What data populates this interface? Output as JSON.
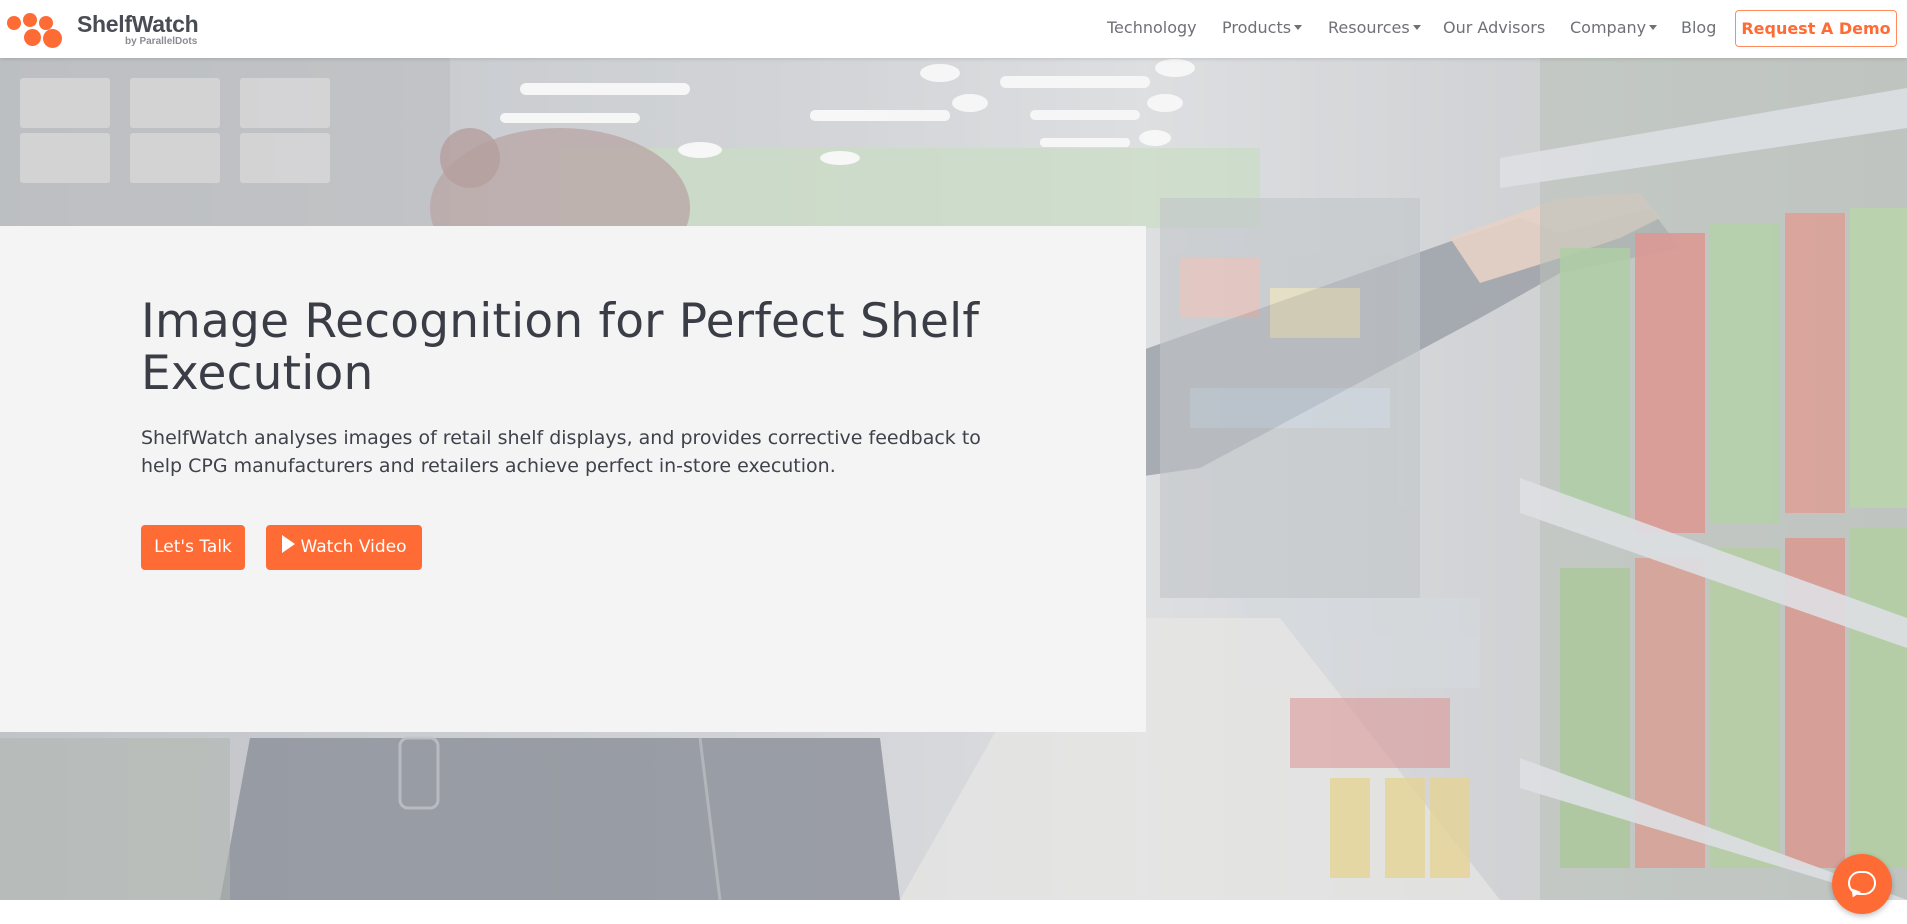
{
  "brand": {
    "name": "ShelfWatch",
    "tagline": "by ParallelDots",
    "accent_color": "#ff6b35"
  },
  "nav": {
    "items": [
      {
        "label": "Technology",
        "has_dropdown": false
      },
      {
        "label": "Products",
        "has_dropdown": true
      },
      {
        "label": "Resources",
        "has_dropdown": true
      },
      {
        "label": "Our Advisors",
        "has_dropdown": false
      },
      {
        "label": "Company",
        "has_dropdown": true
      },
      {
        "label": "Blog",
        "has_dropdown": false
      }
    ],
    "cta_label": "Request A Demo"
  },
  "hero": {
    "headline": "Image Recognition for Perfect Shelf Execution",
    "subtext": "ShelfWatch analyses images of retail shelf displays, and provides corrective feedback to help CPG manufacturers and retailers achieve perfect in-store execution.",
    "primary_button": "Let's Talk",
    "secondary_button": "Watch Video",
    "secondary_icon": "play-icon",
    "background_image": "shopper-reaching-supermarket-shelf"
  },
  "chat": {
    "icon": "chat-icon"
  }
}
